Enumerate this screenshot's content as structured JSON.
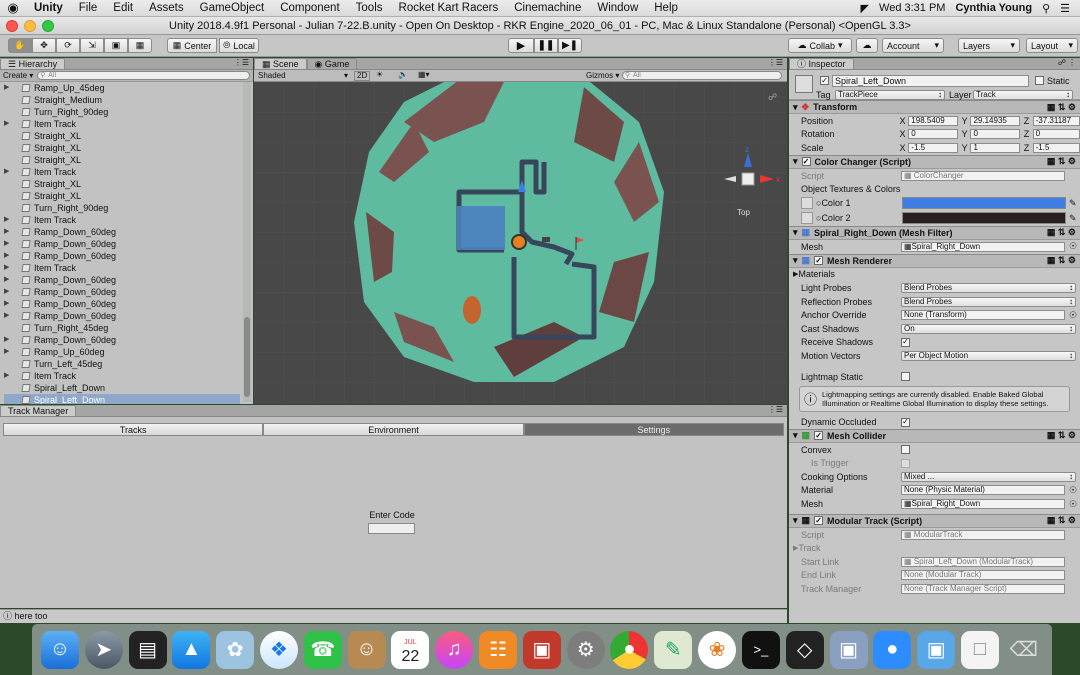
{
  "menubar": {
    "apple": "",
    "app": "Unity",
    "items": [
      "File",
      "Edit",
      "Assets",
      "GameObject",
      "Component",
      "Tools",
      "Rocket Kart Racers",
      "Cinemachine",
      "Window",
      "Help"
    ],
    "clock": "Wed 3:31 PM",
    "user": "Cynthia Young"
  },
  "window": {
    "title": "Unity 2018.4.9f1 Personal - Julian 7-22.B.unity - Open On Desktop - RKR Engine_2020_06_01 - PC, Mac & Linux Standalone (Personal) <OpenGL 3.3>"
  },
  "toolbar": {
    "center": "Center",
    "local": "Local",
    "collab": "Collab",
    "account": "Account",
    "layers": "Layers",
    "layout": "Layout"
  },
  "hierarchy": {
    "tab": "Hierarchy",
    "create": "Create",
    "search_placeholder": "All",
    "items": [
      {
        "label": "Ramp_Up_45deg",
        "arrow": true
      },
      {
        "label": "Straight_Medium",
        "arrow": false
      },
      {
        "label": "Turn_Right_90deg",
        "arrow": false
      },
      {
        "label": "Item Track",
        "arrow": true
      },
      {
        "label": "Straight_XL",
        "arrow": false
      },
      {
        "label": "Straight_XL",
        "arrow": false
      },
      {
        "label": "Straight_XL",
        "arrow": false
      },
      {
        "label": "Item Track",
        "arrow": true
      },
      {
        "label": "Straight_XL",
        "arrow": false
      },
      {
        "label": "Straight_XL",
        "arrow": false
      },
      {
        "label": "Turn_Right_90deg",
        "arrow": false
      },
      {
        "label": "Item Track",
        "arrow": true
      },
      {
        "label": "Ramp_Down_60deg",
        "arrow": true
      },
      {
        "label": "Ramp_Down_60deg",
        "arrow": true
      },
      {
        "label": "Ramp_Down_60deg",
        "arrow": true
      },
      {
        "label": "Item Track",
        "arrow": true
      },
      {
        "label": "Ramp_Down_60deg",
        "arrow": true
      },
      {
        "label": "Ramp_Down_60deg",
        "arrow": true
      },
      {
        "label": "Ramp_Down_60deg",
        "arrow": true
      },
      {
        "label": "Ramp_Down_60deg",
        "arrow": true
      },
      {
        "label": "Turn_Right_45deg",
        "arrow": false
      },
      {
        "label": "Ramp_Down_60deg",
        "arrow": true
      },
      {
        "label": "Ramp_Up_60deg",
        "arrow": true
      },
      {
        "label": "Turn_Left_45deg",
        "arrow": false
      },
      {
        "label": "Item Track",
        "arrow": true
      },
      {
        "label": "Spiral_Left_Down",
        "arrow": false
      },
      {
        "label": "Spiral_Left_Down",
        "arrow": false,
        "selected": true
      }
    ]
  },
  "scene": {
    "tab_scene": "Scene",
    "tab_game": "Game",
    "shading": "Shaded",
    "mode2d": "2D",
    "gizmos": "Gizmos",
    "search_placeholder": "All",
    "view_label": "Top",
    "axis_x": "x",
    "axis_y": "y",
    "axis_z": "z"
  },
  "trackmanager": {
    "title": "Track Manager",
    "tabs": [
      "Tracks",
      "Environment",
      "Settings"
    ],
    "enter_code": "Enter Code",
    "code_value": ""
  },
  "statusbar": {
    "text": "here too"
  },
  "inspector": {
    "tab": "Inspector",
    "name": "Spiral_Left_Down",
    "static": "Static",
    "tag_label": "Tag",
    "tag": "TrackPiece",
    "layer_label": "Layer",
    "layer": "Track",
    "transform": {
      "title": "Transform",
      "position": "Position",
      "rotation": "Rotation",
      "scale": "Scale",
      "px": "198.5409",
      "py": "29.14935",
      "pz": "-37.31187",
      "rx": "0",
      "ry": "0",
      "rz": "0",
      "sx": "-1.5",
      "sy": "1",
      "sz": "-1.5",
      "lx": "X",
      "ly": "Y",
      "lz": "Z"
    },
    "color_changer": {
      "title": "Color Changer (Script)",
      "script_label": "Script",
      "script": "ColorChanger",
      "textures": "Object Textures & Colors",
      "color1": "Color 1",
      "color2": "Color 2",
      "color1_hex": "#3f7fe3",
      "color2_hex": "#2a2020"
    },
    "mesh_filter": {
      "title": "Spiral_Right_Down (Mesh Filter)",
      "mesh_label": "Mesh",
      "mesh": "Spiral_Right_Down"
    },
    "mesh_renderer": {
      "title": "Mesh Renderer",
      "materials": "Materials",
      "light_probes": "Light Probes",
      "light_probes_v": "Blend Probes",
      "reflection_probes": "Reflection Probes",
      "reflection_probes_v": "Blend Probes",
      "anchor": "Anchor Override",
      "anchor_v": "None (Transform)",
      "cast": "Cast Shadows",
      "cast_v": "On",
      "receive": "Receive Shadows",
      "motion": "Motion Vectors",
      "motion_v": "Per Object Motion",
      "lightmap": "Lightmap Static",
      "info": "Lightmapping settings are currently disabled. Enable Baked Global Illumination or Realtime Global Illumination to display these settings.",
      "occluded": "Dynamic Occluded"
    },
    "mesh_collider": {
      "title": "Mesh Collider",
      "convex": "Convex",
      "trigger": "Is Trigger",
      "cooking": "Cooking Options",
      "cooking_v": "Mixed ...",
      "material": "Material",
      "material_v": "None (Physic Material)",
      "mesh": "Mesh",
      "mesh_v": "Spiral_Right_Down"
    },
    "modular": {
      "title": "Modular Track (Script)",
      "script_label": "Script",
      "script": "ModularTrack",
      "track": "Track",
      "start": "Start Link",
      "start_v": "Spiral_Left_Down (ModularTrack)",
      "end": "End Link",
      "end_v": "None (Modular Track)",
      "tm": "Track Manager",
      "tm_v": "None (Track Manager Script)"
    }
  },
  "calendar": {
    "month": "JUL",
    "day": "22"
  },
  "colors": {
    "ground": "#5fbb9f",
    "rock": "#7a5350",
    "track": "#37465a",
    "accent": "#3f7fe3"
  }
}
